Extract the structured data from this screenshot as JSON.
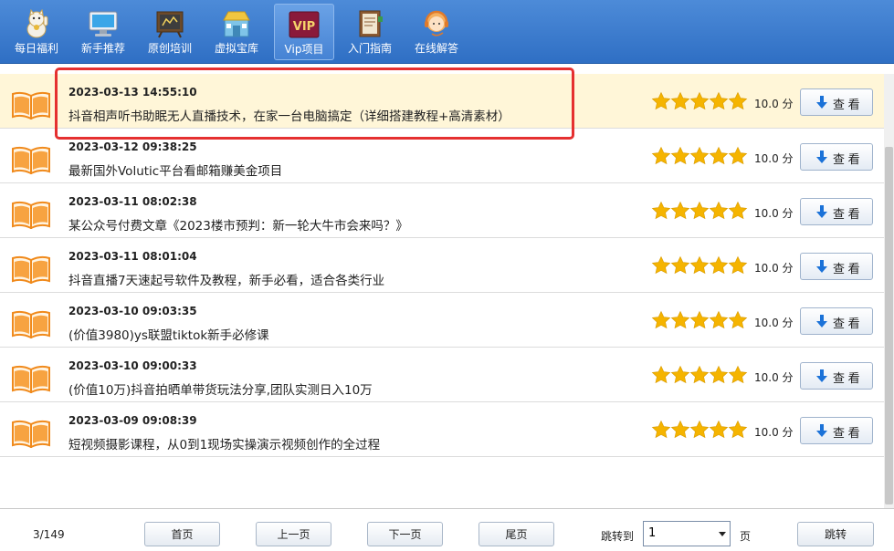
{
  "toolbar": {
    "items": [
      {
        "label": "每日福利",
        "icon": "lucky-cat-icon"
      },
      {
        "label": "新手推荐",
        "icon": "monitor-icon"
      },
      {
        "label": "原创培训",
        "icon": "chalkboard-icon"
      },
      {
        "label": "虚拟宝库",
        "icon": "store-icon"
      },
      {
        "label": "Vip项目",
        "icon": "vip-icon",
        "badge": "VIP",
        "active": true
      },
      {
        "label": "入门指南",
        "icon": "guide-book-icon"
      },
      {
        "label": "在线解答",
        "icon": "support-agent-icon"
      }
    ]
  },
  "list": {
    "rows": [
      {
        "date": "2023-03-13 14:55:10",
        "title": "抖音相声听书助眠无人直播技术，在家一台电脑搞定（详细搭建教程+高清素材）",
        "rating": 5,
        "score": "10.0 分",
        "button": "查 看",
        "selected": true
      },
      {
        "date": "2023-03-12 09:38:25",
        "title": "最新国外Volutic平台看邮箱赚美金项目",
        "rating": 5,
        "score": "10.0 分",
        "button": "查 看"
      },
      {
        "date": "2023-03-11 08:02:38",
        "title": "某公众号付费文章《2023楼市预判：新一轮大牛市会来吗？》",
        "rating": 5,
        "score": "10.0 分",
        "button": "查 看"
      },
      {
        "date": "2023-03-11 08:01:04",
        "title": "抖音直播7天速起号软件及教程，新手必看，适合各类行业",
        "rating": 5,
        "score": "10.0 分",
        "button": "查 看"
      },
      {
        "date": "2023-03-10 09:03:35",
        "title": "(价值3980)ys联盟tiktok新手必修课",
        "rating": 5,
        "score": "10.0 分",
        "button": "查 看"
      },
      {
        "date": "2023-03-10 09:00:33",
        "title": "(价值10万)抖音拍晒单带货玩法分享,团队实测日入10万",
        "rating": 5,
        "score": "10.0 分",
        "button": "查 看"
      },
      {
        "date": "2023-03-09 09:08:39",
        "title": "短视频摄影课程，从0到1现场实操演示视频创作的全过程",
        "rating": 5,
        "score": "10.0 分",
        "button": "查 看"
      }
    ]
  },
  "footer": {
    "page_info": "3/149",
    "first": "首页",
    "prev": "上一页",
    "next": "下一页",
    "last": "尾页",
    "jump_label": "跳转到",
    "page_value": "1",
    "page_unit": "页",
    "jump_button": "跳转"
  },
  "colors": {
    "toolbar": "#3a78cc",
    "star": "#f5b400",
    "selected_row": "#fff6d8",
    "highlight_box": "#e53030",
    "book": "#f08a1c",
    "view_arrow": "#1b72d8"
  }
}
